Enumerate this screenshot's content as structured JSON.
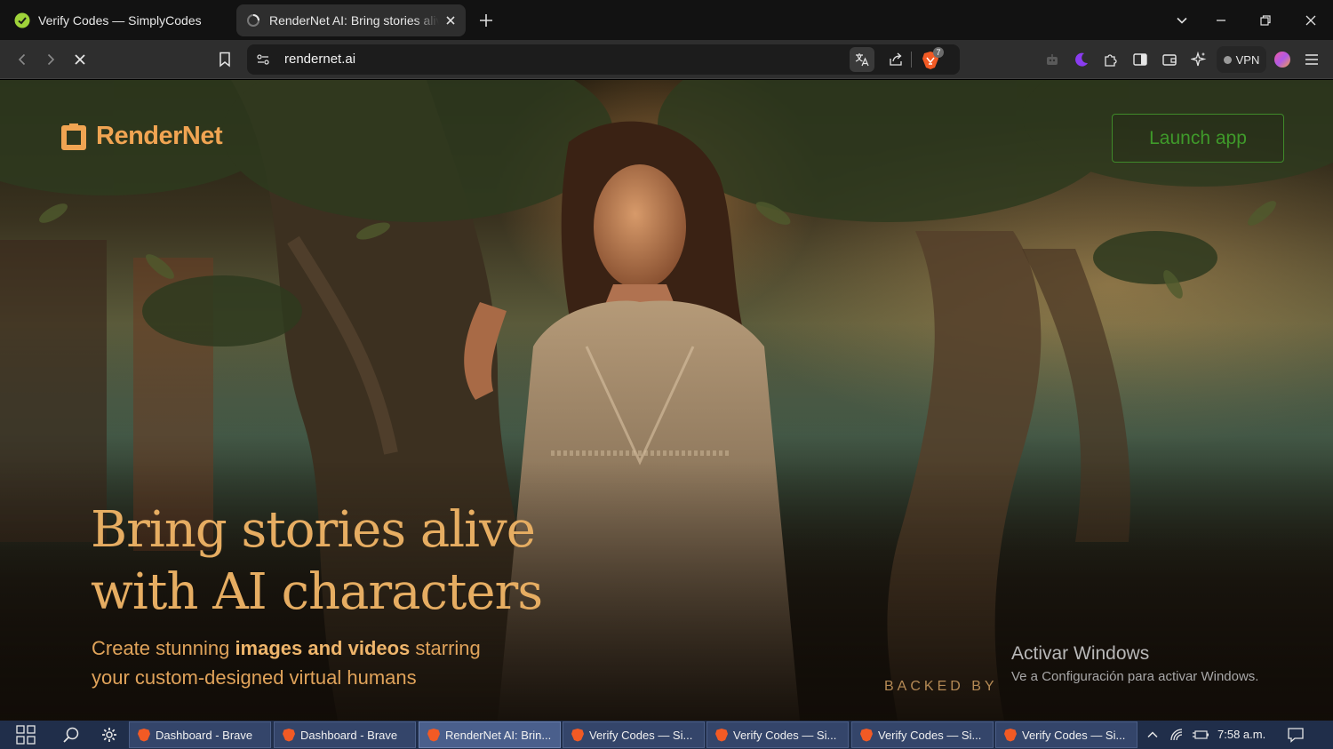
{
  "browser": {
    "tabs": [
      {
        "title": "Verify Codes — SimplyCodes",
        "active": false
      },
      {
        "title": "RenderNet AI: Bring stories alive with AI characters",
        "active": true
      }
    ],
    "address": "rendernet.ai",
    "shields_count": "7",
    "vpn_label": "VPN"
  },
  "page": {
    "logo": "RenderNet",
    "launch_button": "Launch app",
    "headline_line1": "Bring stories alive",
    "headline_line2": "with AI characters",
    "subhead_part1": "Create stunning ",
    "subhead_bold": "images and videos",
    "subhead_part2": " starring",
    "subhead_line2": "your custom-designed virtual humans",
    "backed_by": "BACKED BY",
    "accent_color": "#e6ad62",
    "launch_color": "#3f9a2a"
  },
  "watermark": {
    "title": "Activar Windows",
    "subtitle": "Ve a Configuración para activar Windows."
  },
  "taskbar": {
    "tasks": [
      {
        "label": "Dashboard - Brave",
        "active": false
      },
      {
        "label": "Dashboard - Brave",
        "active": false
      },
      {
        "label": "RenderNet AI: Brin...",
        "active": true
      },
      {
        "label": "Verify Codes — Si...",
        "active": false
      },
      {
        "label": "Verify Codes — Si...",
        "active": false
      },
      {
        "label": "Verify Codes — Si...",
        "active": false
      },
      {
        "label": "Verify Codes — Si...",
        "active": false
      }
    ],
    "clock": "7:58 a.m."
  }
}
